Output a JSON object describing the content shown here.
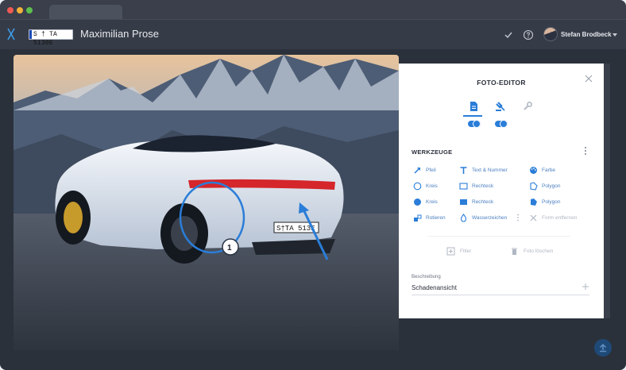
{
  "app": {
    "license_plate": "S † TA 5130E",
    "title": "Maximilian Prose",
    "user_name": "Stefan Brodbeck",
    "accent_color": "#2a7dd8"
  },
  "photo": {
    "car_plate": "S†TA 513E",
    "marker_number": "1"
  },
  "editor": {
    "title": "FOTO-EDITOR",
    "section_title": "WERKZEUGE",
    "tools": [
      {
        "label": "Pfeil",
        "icon": "arrow-icon",
        "enabled": true
      },
      {
        "label": "Text & Nummer",
        "icon": "text-icon",
        "enabled": true
      },
      {
        "label": "Farbe",
        "icon": "palette-icon",
        "enabled": true
      },
      {
        "label": "Kreis",
        "icon": "circle-outline-icon",
        "enabled": true
      },
      {
        "label": "Rechteck",
        "icon": "rectangle-outline-icon",
        "enabled": true
      },
      {
        "label": "Polygon",
        "icon": "polygon-outline-icon",
        "enabled": true
      },
      {
        "label": "Kreis",
        "icon": "circle-filled-icon",
        "enabled": true
      },
      {
        "label": "Rechteck",
        "icon": "rectangle-filled-icon",
        "enabled": true
      },
      {
        "label": "Polygon",
        "icon": "polygon-filled-icon",
        "enabled": true
      },
      {
        "label": "Rotieren",
        "icon": "rotate-icon",
        "enabled": true
      },
      {
        "label": "Wasserzeichen",
        "icon": "watermark-drop-icon",
        "enabled": true
      },
      {
        "label": "Form entfernen",
        "icon": "remove-shape-icon",
        "enabled": false
      }
    ],
    "filter_label": "Filter",
    "delete_label": "Foto löschen",
    "description_label": "Beschreibung",
    "description_value": "Schadenansicht"
  }
}
